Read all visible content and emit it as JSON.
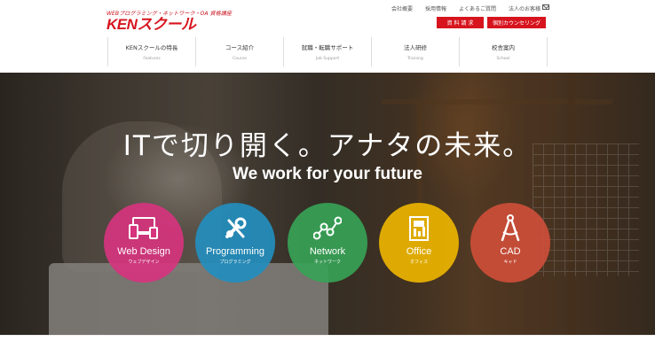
{
  "logo": {
    "tagline": "WEBプログラミング・ネットワーク・OA 資格講座",
    "name": "KENスクール"
  },
  "util_links": [
    "会社概要",
    "採用情報",
    "よくあるご質問",
    "法人のお客様"
  ],
  "buttons": {
    "request": "資 料 請 求",
    "counsel": "個別カウンセリング"
  },
  "nav": [
    {
      "jp": "KENスクールの特長",
      "en": "Features"
    },
    {
      "jp": "コース紹介",
      "en": "Course"
    },
    {
      "jp": "就職・転職サポート",
      "en": "Job Support"
    },
    {
      "jp": "法人研修",
      "en": "Training"
    },
    {
      "jp": "校舎案内",
      "en": "School"
    }
  ],
  "hero": {
    "catch": "ITで切り開く。アナタの未来。",
    "sub": "We work for your future"
  },
  "courses": [
    {
      "en": "Web Design",
      "jp": "ウェブデザイン",
      "icon": "devices-icon",
      "color": "#d6347e"
    },
    {
      "en": "Programming",
      "jp": "プログラミング",
      "icon": "tools-icon",
      "color": "#238ebe"
    },
    {
      "en": "Network",
      "jp": "ネットワーク",
      "icon": "network-icon",
      "color": "#37a256"
    },
    {
      "en": "Office",
      "jp": "オフィス",
      "icon": "document-icon",
      "color": "#ecb400"
    },
    {
      "en": "CAD",
      "jp": "キャド",
      "icon": "compass-icon",
      "color": "#cd4e3a"
    }
  ]
}
